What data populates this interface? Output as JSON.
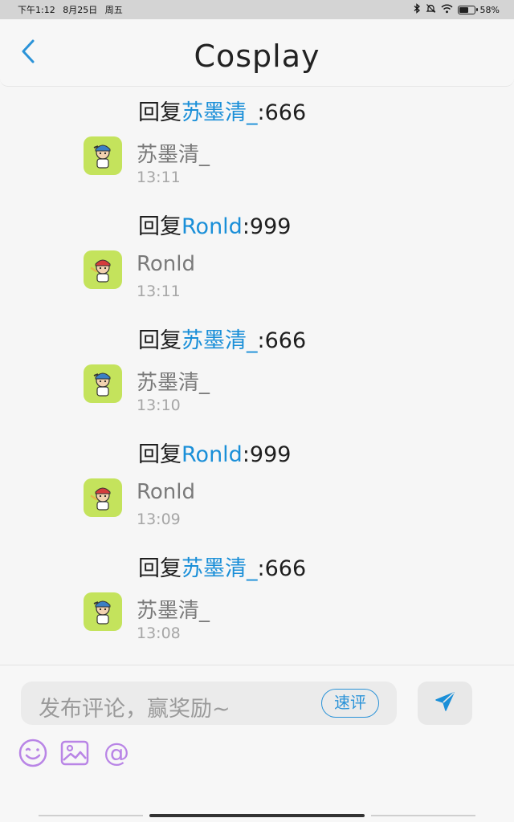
{
  "status_bar": {
    "time": "下午1:12",
    "date": "8月25日",
    "weekday": "周五",
    "battery": "58%",
    "battery_level": 0.58,
    "icons": [
      "bluetooth-icon",
      "mute-icon",
      "wifi-icon",
      "battery-icon"
    ]
  },
  "header": {
    "title": "Cosplay",
    "back_icon": "chevron-left-icon"
  },
  "colors": {
    "accent": "#1a8fd8",
    "avatar_bg": "#c4e35c",
    "emoji_purple": "#b985e6"
  },
  "comments": [
    {
      "reply_prefix": "回复",
      "reply_to": "苏墨清_",
      "reply_content": ":666",
      "user": "苏墨清_",
      "time": "13:11"
    },
    {
      "reply_prefix": "回复",
      "reply_to": "Ronld",
      "reply_content": ":999",
      "user": "Ronld",
      "time": "13:11"
    },
    {
      "reply_prefix": "回复",
      "reply_to": "苏墨清_",
      "reply_content": ":666",
      "user": "苏墨清_",
      "time": "13:10"
    },
    {
      "reply_prefix": "回复",
      "reply_to": "Ronld",
      "reply_content": ":999",
      "user": "Ronld",
      "time": "13:09"
    },
    {
      "reply_prefix": "回复",
      "reply_to": "苏墨清_",
      "reply_content": ":666",
      "user": "苏墨清_",
      "time": "13:08"
    }
  ],
  "input": {
    "placeholder": "发布评论，赢奖励~",
    "quick_comment_label": "速评",
    "send_icon": "send-icon"
  },
  "toolbar": {
    "icons": [
      "emoji-icon",
      "image-icon",
      "at-icon"
    ]
  }
}
